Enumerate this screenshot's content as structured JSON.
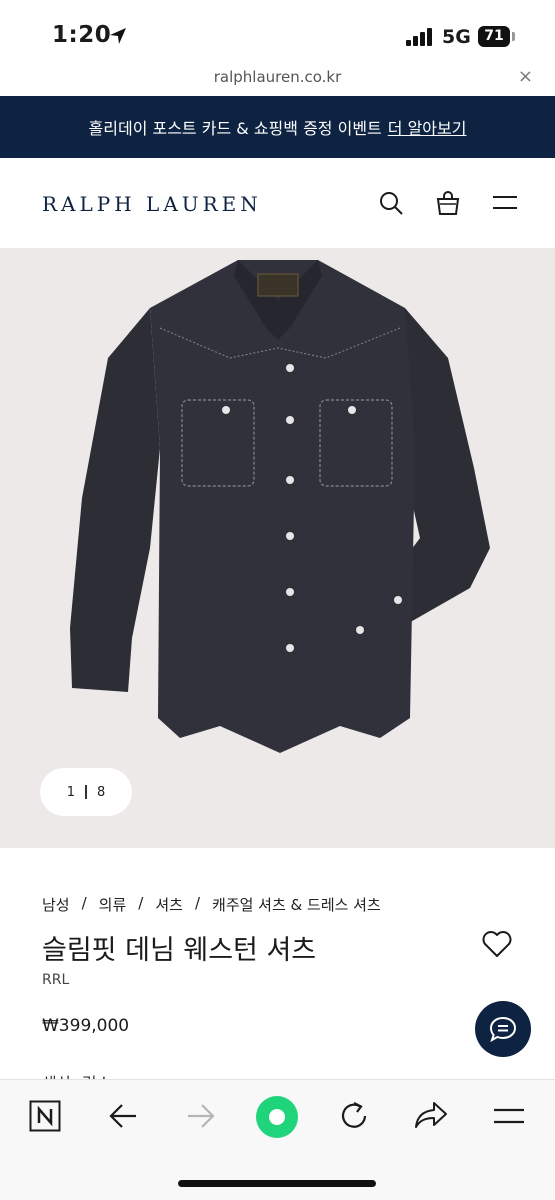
{
  "status": {
    "time": "1:20",
    "network": "5G",
    "battery": "71"
  },
  "browser": {
    "url": "ralphlauren.co.kr",
    "close": "×"
  },
  "promo": {
    "text": "홀리데이 포스트 카드 & 쇼핑백 증정 이벤트",
    "link": "더 알아보기"
  },
  "header": {
    "logo": "RALPH LAUREN",
    "icons": [
      "search-icon",
      "bag-icon",
      "menu-icon"
    ]
  },
  "gallery": {
    "current": "1",
    "total": "8"
  },
  "breadcrumb": [
    "남성",
    "/",
    "의류",
    "/",
    "셔츠",
    "/",
    "캐주얼 셔츠 & 드레스 셔츠"
  ],
  "product": {
    "name": "슬림핏 데님 웨스턴 셔츠",
    "brand": "RRL",
    "price": "₩399,000",
    "partial_label": "색상: 린스"
  },
  "colors": {
    "navy": "#0e2342",
    "green": "#1fd47a",
    "bg": "#ece9e8"
  },
  "toolbar": {
    "icons": [
      "naver-n-icon",
      "back-arrow-icon",
      "forward-arrow-icon",
      "home-green-icon",
      "refresh-icon",
      "share-icon",
      "menu-icon"
    ]
  }
}
